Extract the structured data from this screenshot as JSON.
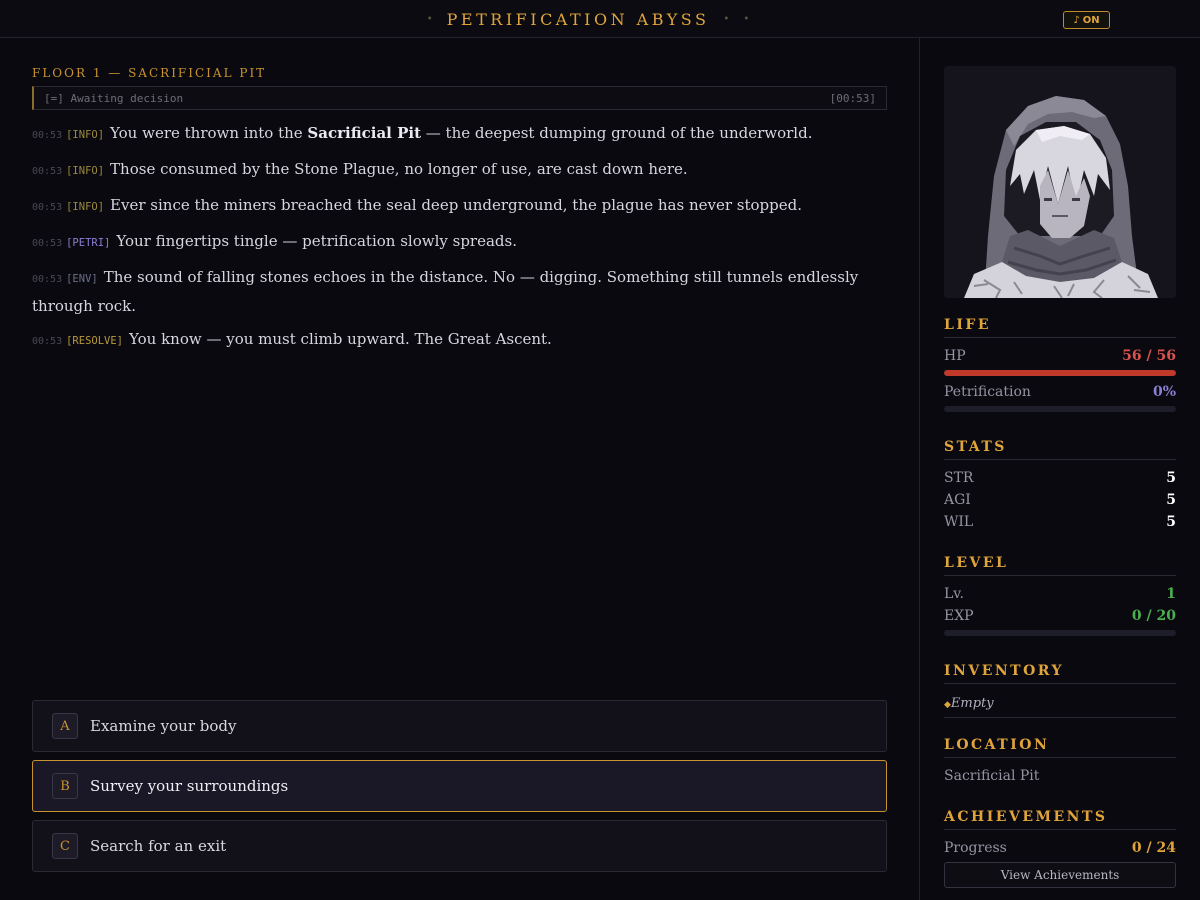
{
  "header": {
    "title": "PETRIFICATION ABYSS",
    "music_label": "ON",
    "music_icon": "music-note-icon"
  },
  "floor": {
    "title": "FLOOR 1 — SACRIFICIAL PIT",
    "status_text": "[=] Awaiting decision",
    "status_time": "[00:53]"
  },
  "log": [
    {
      "time": "00:53",
      "tag": "[INFO]",
      "kind": "info",
      "before": "You were thrown into the ",
      "bold": "Sacrificial Pit",
      "after": " — the deepest dumping ground of the underworld."
    },
    {
      "time": "00:53",
      "tag": "[INFO]",
      "kind": "info",
      "before": "Those consumed by the Stone Plague, no longer of use, are cast down here.",
      "bold": "",
      "after": ""
    },
    {
      "time": "00:53",
      "tag": "[INFO]",
      "kind": "info",
      "before": "Ever since the miners breached the seal deep underground, the plague has never stopped.",
      "bold": "",
      "after": ""
    },
    {
      "time": "00:53",
      "tag": "[PETRI]",
      "kind": "petri",
      "before": "Your fingertips tingle — petrification slowly spreads.",
      "bold": "",
      "after": ""
    },
    {
      "time": "00:53",
      "tag": "[ENV]",
      "kind": "env",
      "before": "The sound of falling stones echoes in the distance. No — digging. Something still tunnels endlessly through rock.",
      "bold": "",
      "after": ""
    },
    {
      "time": "00:53",
      "tag": "[RESOLVE]",
      "kind": "resolve",
      "before": "You know — you must climb upward. The Great Ascent.",
      "bold": "",
      "after": ""
    }
  ],
  "choices": [
    {
      "key": "A",
      "label": "Examine your body"
    },
    {
      "key": "B",
      "label": "Survey your surroundings"
    },
    {
      "key": "C",
      "label": "Search for an exit"
    }
  ],
  "selected_choice": "B",
  "life": {
    "title": "LIFE",
    "hp_label": "HP",
    "hp_value": "56 / 56",
    "hp_fraction": 1.0,
    "petri_label": "Petrification",
    "petri_value": "0%",
    "petri_fraction": 0.0
  },
  "stats": {
    "title": "STATS",
    "items": [
      {
        "label": "STR",
        "value": "5"
      },
      {
        "label": "AGI",
        "value": "5"
      },
      {
        "label": "WIL",
        "value": "5"
      }
    ]
  },
  "level": {
    "title": "LEVEL",
    "lv_label": "Lv.",
    "lv_value": "1",
    "exp_label": "EXP",
    "exp_value": "0 / 20",
    "exp_fraction": 0.0
  },
  "inventory": {
    "title": "INVENTORY",
    "empty_text": "Empty"
  },
  "location": {
    "title": "LOCATION",
    "value": "Sacrificial Pit"
  },
  "achievements": {
    "title": "ACHIEVEMENTS",
    "progress_label": "Progress",
    "progress_value": "0 / 24",
    "button_label": "View Achievements"
  },
  "colors": {
    "accent": "#e0a53a",
    "hp": "#d9534f",
    "hp_bar": "#c0392b",
    "petri": "#8a7fd4",
    "exp": "#4caf50"
  }
}
